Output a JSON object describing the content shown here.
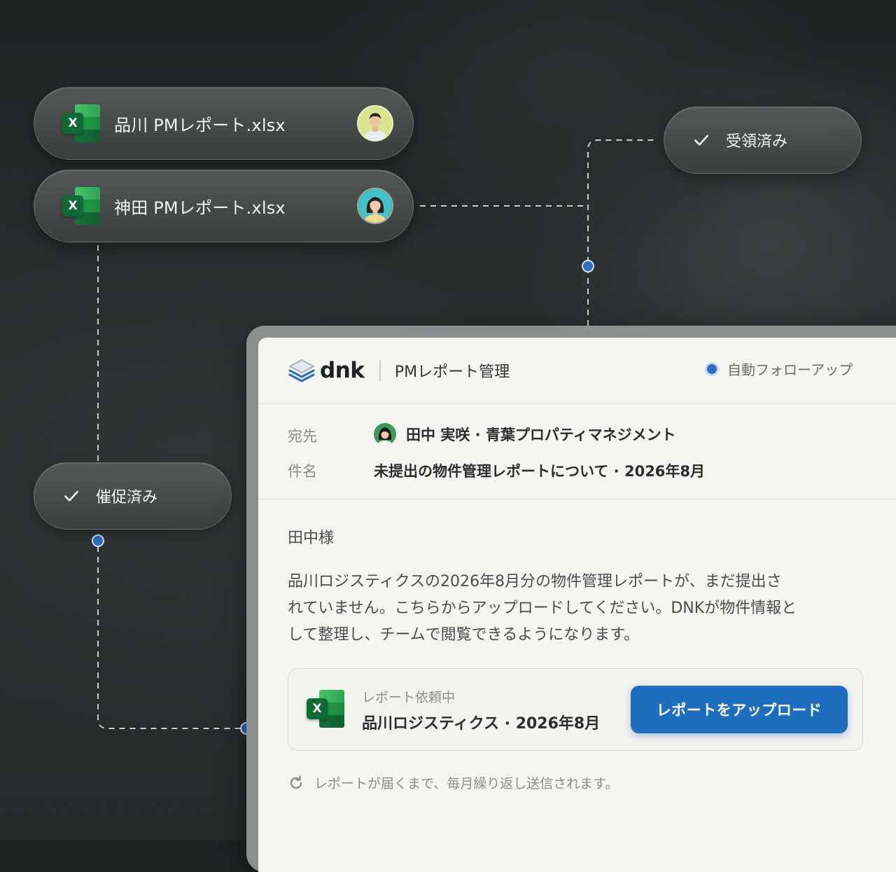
{
  "files": [
    {
      "name": "品川 PMレポート.xlsx",
      "icon": "excel-icon",
      "avatar": "avatar-man"
    },
    {
      "name": "神田 PMレポート.xlsx",
      "icon": "excel-icon",
      "avatar": "avatar-woman"
    }
  ],
  "status": {
    "received": "受領済み",
    "reminded": "催促済み"
  },
  "app": {
    "logo": "dnk",
    "title": "PMレポート管理",
    "auto_follow": "自動フォローアップ"
  },
  "email": {
    "to_label": "宛先",
    "to_value": "田中 実咲 · 青葉プロパティマネジメント",
    "subject_label": "件名",
    "subject_value": "未提出の物件管理レポートについて · 2026年8月",
    "greeting": "田中様",
    "body_lines": [
      "品川ロジスティクスの2026年8月分の物件管理レポートが、まだ提出さ",
      "れていません。こちらからアップロードしてください。DNKが物件情報と",
      "して整理し、チームで閲覧できるようになります。"
    ]
  },
  "request_card": {
    "status": "レポート依頼中",
    "title": "品川ロジスティクス · 2026年8月",
    "button": "レポートをアップロード"
  },
  "footer_note": "レポートが届くまで、毎月繰り返し送信されます。",
  "colors": {
    "accent": "#1f6dbf",
    "excel_green": "#1b8a3e"
  }
}
